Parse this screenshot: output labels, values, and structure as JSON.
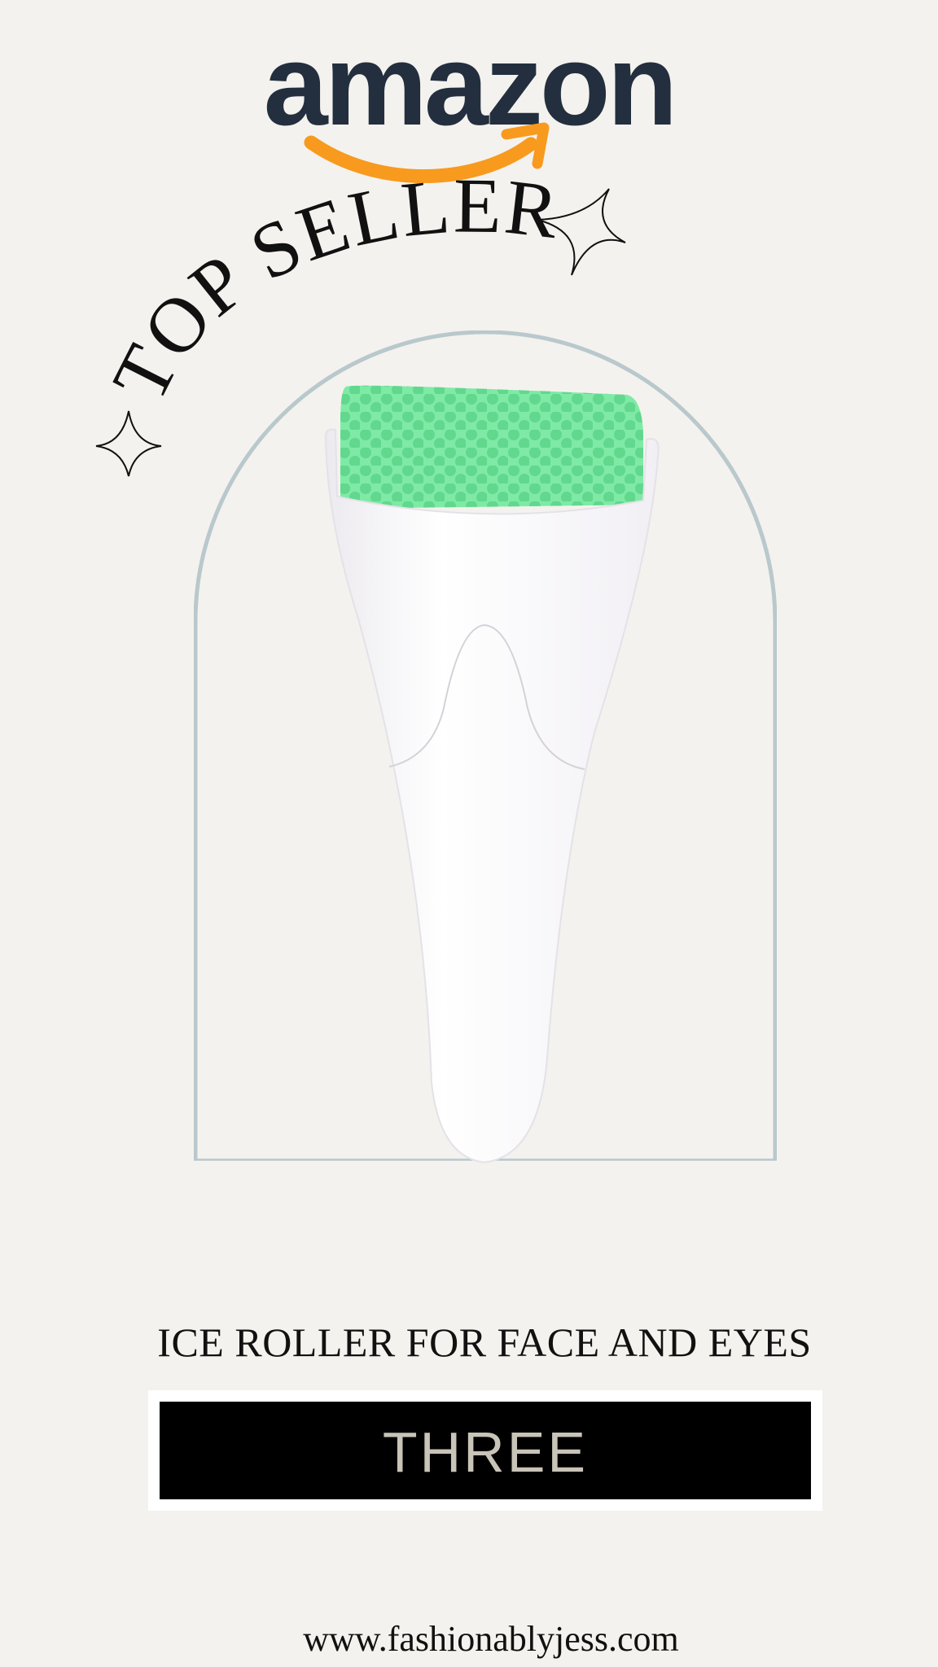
{
  "brand": {
    "logo_text": "amazon",
    "logo_text_color": "#232f3e",
    "smile_color": "#f79a1e"
  },
  "banner": {
    "text": "TOP SELLER",
    "sparkle_icon": "four-point-star-icon"
  },
  "product": {
    "title": "ICE ROLLER FOR FACE AND EYES",
    "rank_label": "THREE",
    "image_description_icon": "ice-roller-image",
    "roller_color": "#6fe39a",
    "handle_color": "#ffffff",
    "arch_color": "#b9c8cc"
  },
  "footer": {
    "website": "www.fashionablyjess.com"
  },
  "colors": {
    "background": "#f4f2ee",
    "badge_background": "#000000",
    "badge_text": "#c9c4b8"
  }
}
